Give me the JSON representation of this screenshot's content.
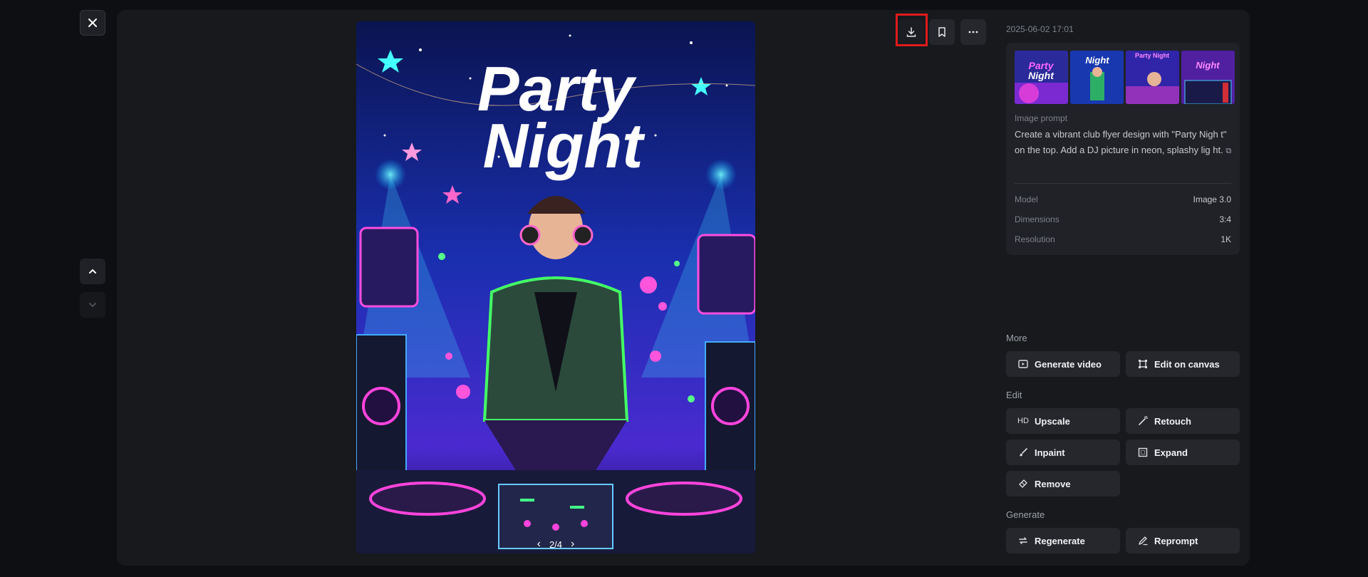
{
  "image": {
    "title_line1": "Party",
    "title_line2": "Night",
    "pager": "2/4"
  },
  "timestamp": "2025-06-02 17:01",
  "prompt": {
    "label": "Image prompt",
    "text": "Create a vibrant club flyer design with \"Party Nigh t\" on the top. Add a DJ picture in neon, splashy lig ht."
  },
  "meta": [
    {
      "key": "Model",
      "value": "Image 3.0"
    },
    {
      "key": "Dimensions",
      "value": "3:4"
    },
    {
      "key": "Resolution",
      "value": "1K"
    }
  ],
  "sections": {
    "more": "More",
    "edit": "Edit",
    "generate": "Generate"
  },
  "buttons": {
    "generate_video": "Generate video",
    "edit_on_canvas": "Edit on canvas",
    "upscale": "Upscale",
    "retouch": "Retouch",
    "inpaint": "Inpaint",
    "expand": "Expand",
    "remove": "Remove",
    "regenerate": "Regenerate",
    "reprompt": "Reprompt"
  },
  "icons": {
    "hd": "HD"
  }
}
